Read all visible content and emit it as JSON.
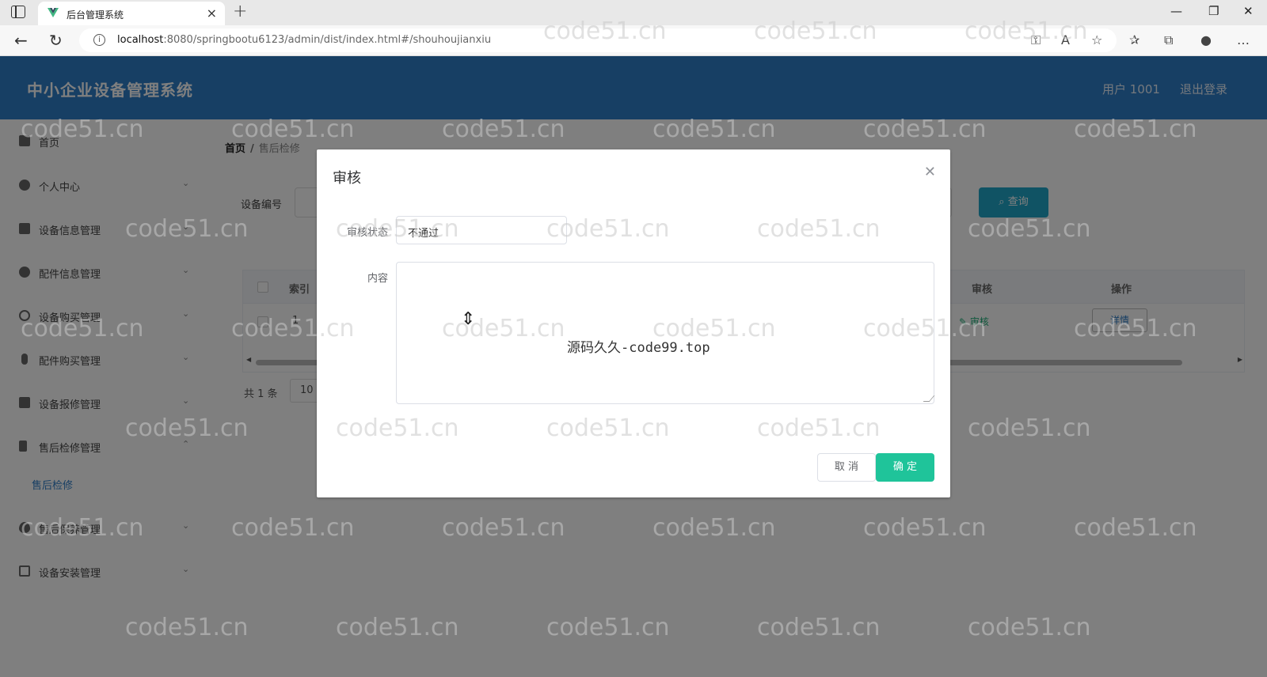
{
  "browser": {
    "tab_title": "后台管理系统",
    "url_host": "localhost",
    "url_rest": ":8080/springbootu6123/admin/dist/index.html#/shouhoujianxiu"
  },
  "header": {
    "title": "中小企业设备管理系统",
    "user": "用户 1001",
    "logout": "退出登录",
    "color": "#2f7ec8"
  },
  "sidebar": {
    "items": [
      {
        "label": "首页",
        "icon": "home-icon"
      },
      {
        "label": "个人中心",
        "icon": "user-icon"
      },
      {
        "label": "设备信息管理",
        "icon": "list-icon"
      },
      {
        "label": "配件信息管理",
        "icon": "user-icon"
      },
      {
        "label": "设备购买管理",
        "icon": "clock-icon"
      },
      {
        "label": "配件购买管理",
        "icon": "mic-icon"
      },
      {
        "label": "设备报修管理",
        "icon": "monitor-icon"
      },
      {
        "label": "售后检修管理",
        "icon": "flag-icon"
      },
      {
        "label": "售后保养管理",
        "icon": "pear-icon"
      },
      {
        "label": "设备安装管理",
        "icon": "chat-icon"
      }
    ],
    "submenu_active": "售后检修"
  },
  "main": {
    "breadcrumb_home": "首页",
    "breadcrumb_sep": "/",
    "breadcrumb_current": "售后检修",
    "search_label": "设备编号",
    "search_button": "查询",
    "table": {
      "headers": {
        "index": "索引",
        "audit": "审核",
        "ops": "操作"
      },
      "row": {
        "index": "1",
        "audit_link": "审核",
        "detail_button": "详情"
      }
    },
    "pager_total": "共 1 条",
    "pager_size": "10"
  },
  "dialog": {
    "title": "审核",
    "status_label": "审核状态",
    "status_value": "不通过",
    "content_label": "内容",
    "content_value": "",
    "cancel": "取 消",
    "confirm": "确 定",
    "confirm_color": "#1fc49a"
  },
  "overlay_text": "源码久久-code99.top",
  "watermark": "code51.cn"
}
